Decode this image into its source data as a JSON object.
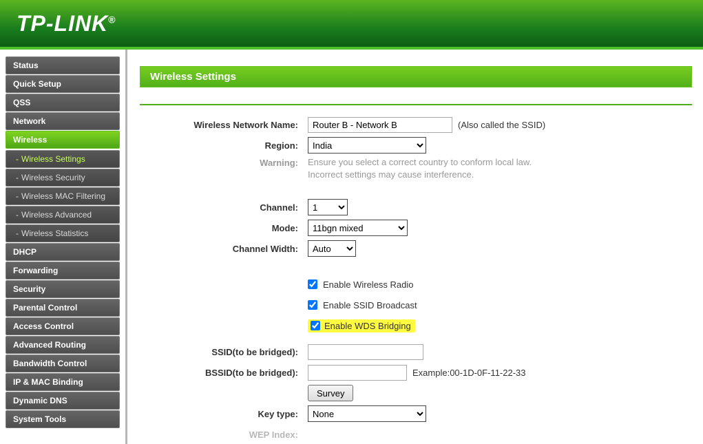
{
  "brand": {
    "name": "TP-LINK",
    "reg": "®"
  },
  "sidebar": {
    "items": [
      {
        "label": "Status"
      },
      {
        "label": "Quick Setup"
      },
      {
        "label": "QSS"
      },
      {
        "label": "Network"
      },
      {
        "label": "Wireless",
        "active": true,
        "sub": [
          {
            "label": "Wireless Settings",
            "active": true
          },
          {
            "label": "Wireless Security"
          },
          {
            "label": "Wireless MAC Filtering"
          },
          {
            "label": "Wireless Advanced"
          },
          {
            "label": "Wireless Statistics"
          }
        ]
      },
      {
        "label": "DHCP"
      },
      {
        "label": "Forwarding"
      },
      {
        "label": "Security"
      },
      {
        "label": "Parental Control"
      },
      {
        "label": "Access Control"
      },
      {
        "label": "Advanced Routing"
      },
      {
        "label": "Bandwidth Control"
      },
      {
        "label": "IP & MAC Binding"
      },
      {
        "label": "Dynamic DNS"
      },
      {
        "label": "System Tools"
      }
    ]
  },
  "page": {
    "title": "Wireless Settings"
  },
  "form": {
    "ssid": {
      "label": "Wireless Network Name:",
      "value": "Router B - Network B",
      "aside": "(Also called the SSID)"
    },
    "region": {
      "label": "Region:",
      "selected": "India"
    },
    "warning": {
      "label": "Warning:",
      "line1": "Ensure you select a correct country to conform local law.",
      "line2": "Incorrect settings may cause interference."
    },
    "channel": {
      "label": "Channel:",
      "selected": "1"
    },
    "mode": {
      "label": "Mode:",
      "selected": "11bgn mixed"
    },
    "channel_width": {
      "label": "Channel Width:",
      "selected": "Auto"
    },
    "enable_radio": {
      "label": "Enable Wireless Radio",
      "checked": true
    },
    "enable_broadcast": {
      "label": "Enable SSID Broadcast",
      "checked": true
    },
    "enable_wds": {
      "label": "Enable WDS Bridging",
      "checked": true
    },
    "bridge_ssid": {
      "label": "SSID(to be bridged):",
      "value": ""
    },
    "bridge_bssid": {
      "label": "BSSID(to be bridged):",
      "value": "",
      "example": "Example:00-1D-0F-11-22-33"
    },
    "survey": {
      "label": "Survey"
    },
    "key_type": {
      "label": "Key type:",
      "selected": "None"
    },
    "wep_index": {
      "label": "WEP Index:"
    }
  }
}
